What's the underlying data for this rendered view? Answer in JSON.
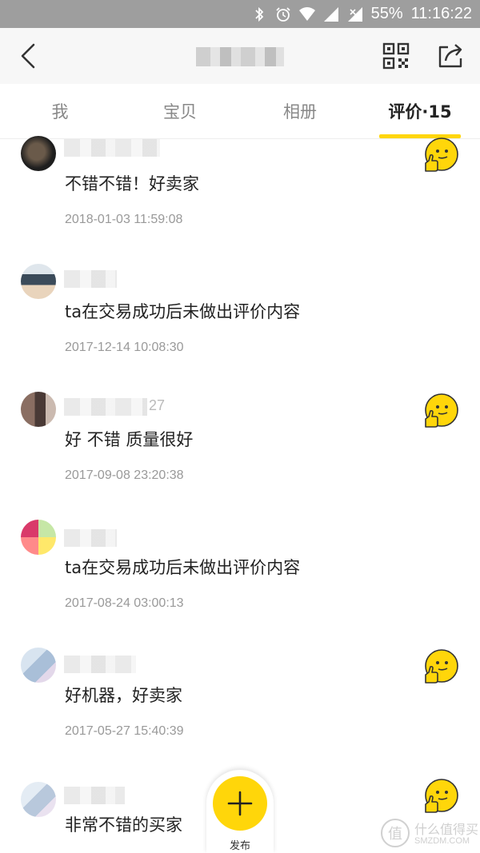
{
  "status_bar": {
    "battery": "55%",
    "time": "11:16:22",
    "icons": [
      "bluetooth-icon",
      "alarm-icon",
      "wifi-icon",
      "cell-signal-icon",
      "no-sim-signal-icon"
    ]
  },
  "nav": {
    "back_icon": "chevron-left-icon",
    "qr_icon": "qr-code-icon",
    "share_icon": "share-icon"
  },
  "tabs": [
    {
      "label": "我"
    },
    {
      "label": "宝贝"
    },
    {
      "label": "相册"
    },
    {
      "label": "评价·15",
      "active": true
    }
  ],
  "reviews": [
    {
      "content": "不错不错！好卖家",
      "timestamp": "2018-01-03 11:59:08",
      "rating_icon": "thumbs-up-emoji-icon"
    },
    {
      "content": "ta在交易成功后未做出评价内容",
      "timestamp": "2017-12-14 10:08:30"
    },
    {
      "name_suffix": "27",
      "content": "好 不错 质量很好",
      "timestamp": "2017-09-08 23:20:38",
      "rating_icon": "thumbs-up-emoji-icon"
    },
    {
      "content": "ta在交易成功后未做出评价内容",
      "timestamp": "2017-08-24 03:00:13"
    },
    {
      "content": "好机器，好卖家",
      "timestamp": "2017-05-27 15:40:39",
      "rating_icon": "thumbs-up-emoji-icon"
    },
    {
      "content": "非常不错的买家",
      "rating_icon": "thumbs-up-emoji-icon"
    }
  ],
  "publish": {
    "label": "发布",
    "icon": "plus-icon"
  },
  "watermark": {
    "text": "什么值得买",
    "domain": "SMZDM.COM"
  },
  "colors": {
    "accent": "#ffd60a",
    "status_bar": "#9e9e9e",
    "nav_bg": "#f7f7f7"
  }
}
